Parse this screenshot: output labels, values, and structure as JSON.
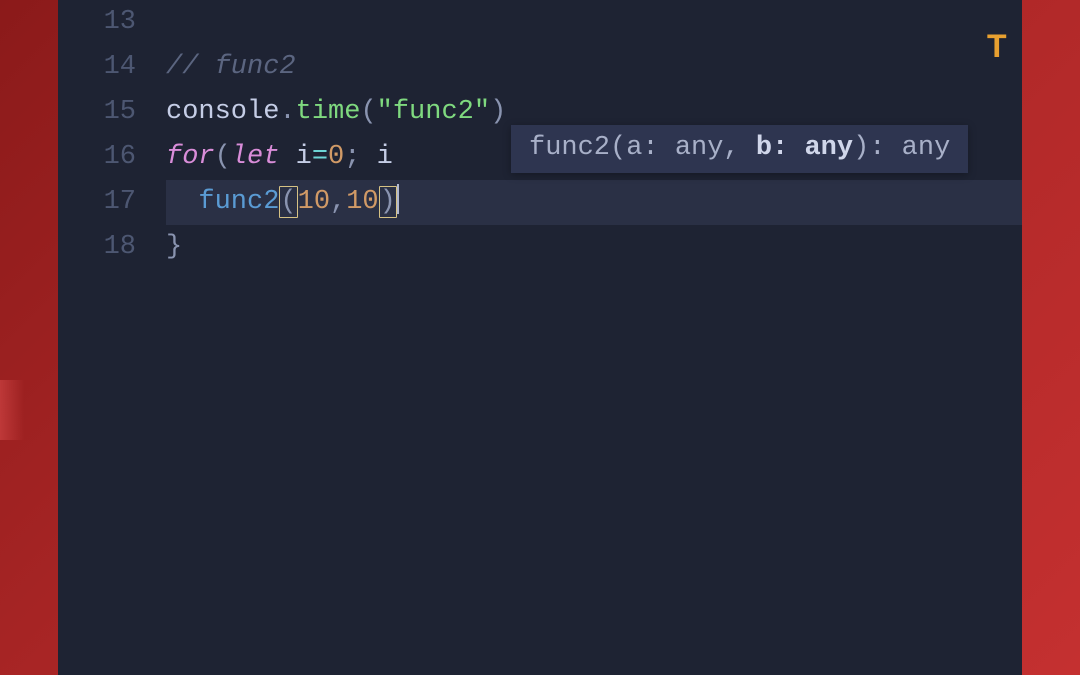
{
  "gutter": {
    "lines": [
      "13",
      "14",
      "15",
      "16",
      "17",
      "18"
    ]
  },
  "code": {
    "line13": "",
    "line14": {
      "comment": "// func2"
    },
    "line15": {
      "obj": "console",
      "dot": ".",
      "method": "time",
      "open": "(",
      "str": "\"func2\"",
      "close": ")"
    },
    "line16": {
      "for": "for",
      "open": "(",
      "let": "let",
      "space1": " ",
      "var": "i",
      "eq": "=",
      "zero": "0",
      "semi": ";",
      "space2": " ",
      "var2": "i "
    },
    "line17": {
      "indent": "  ",
      "func": "func2",
      "lparen": "(",
      "arg1": "10",
      "comma": ",",
      "arg2": "10",
      "rparen": ")"
    },
    "line18": {
      "brace": "}"
    }
  },
  "signature": {
    "prefix": "func2(a: any, ",
    "bold": "b: any",
    "suffix": "): any"
  },
  "minimap": {
    "indicator": "T"
  }
}
